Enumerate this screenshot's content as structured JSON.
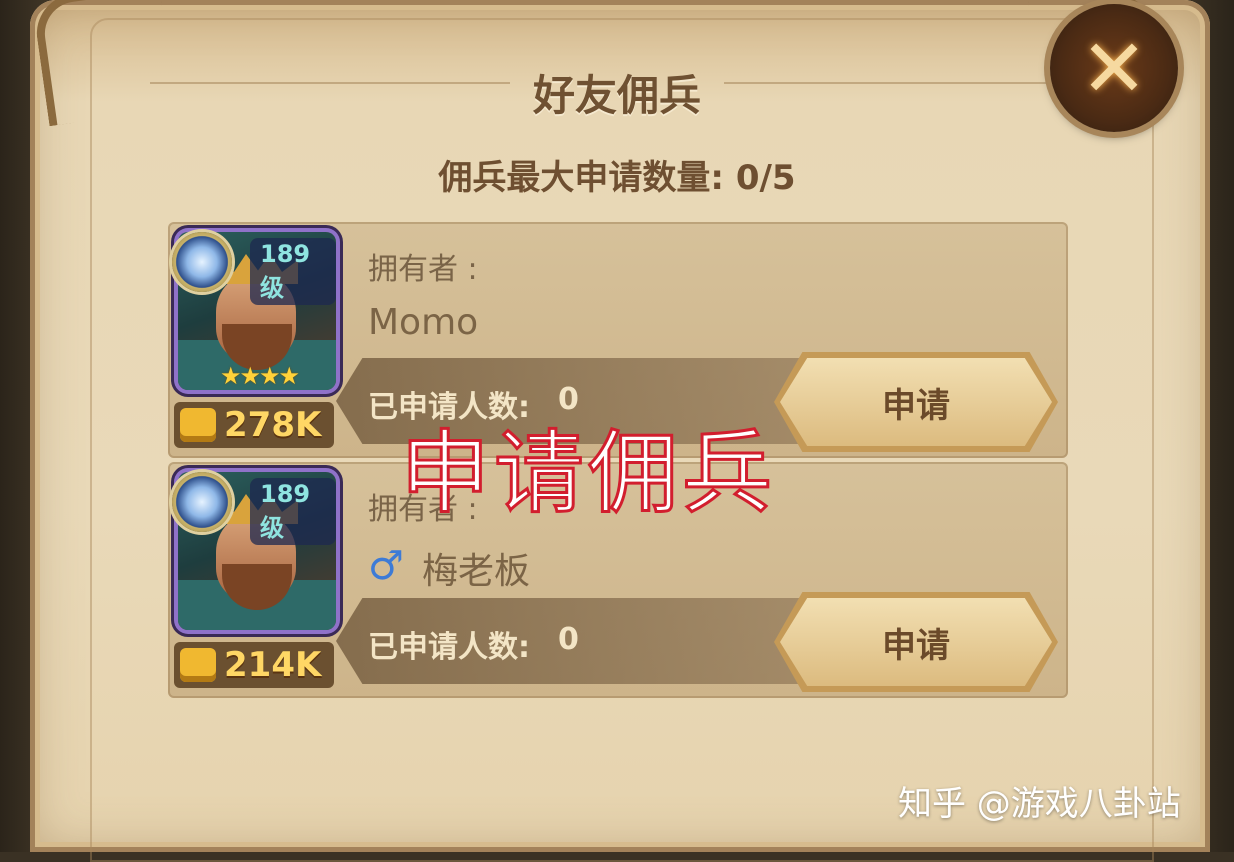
{
  "header": {
    "title": "好友佣兵",
    "close_icon": "close-icon"
  },
  "limit_text": "佣兵最大申请数量: 0/5",
  "mercenaries": [
    {
      "level": "189级",
      "stars": "★★★★",
      "power": "278K",
      "owner_label": "拥有者 :",
      "owner_name": "Momo",
      "apply_count_label": "已申请人数:",
      "apply_count": "0",
      "apply_button": "申请"
    },
    {
      "level": "189级",
      "power": "214K",
      "owner_label": "拥有者 :",
      "gender_symbol": "♂",
      "owner_name": "梅老板",
      "apply_count_label": "已申请人数:",
      "apply_count": "0",
      "apply_button": "申请"
    }
  ],
  "overlay_caption": "申请佣兵",
  "credit": "知乎 @游戏八卦站",
  "colors": {
    "panel": "#e9d9b8",
    "title_text": "#6f5132",
    "power_text": "#ffd765",
    "overlay_stroke": "#d21e2e",
    "gender_male": "#3d7bd6"
  }
}
